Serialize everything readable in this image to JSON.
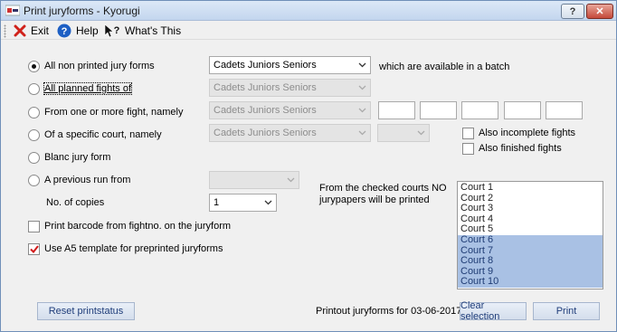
{
  "window": {
    "title": "Print juryforms - Kyorugi",
    "help_button": "?",
    "close_button": "✕"
  },
  "menu": {
    "exit": "Exit",
    "help": "Help",
    "whats_this": "What's This"
  },
  "options": {
    "all_non_printed": "All non printed jury forms",
    "all_planned": "All planned fights of",
    "from_fights": "From one or more fight, namely",
    "specific_court": "Of a specific court, namely",
    "blanc": "Blanc jury form",
    "previous_run": "A previous run from",
    "copies_label": "No. of copies"
  },
  "combos": {
    "category_1": "Cadets Juniors Seniors",
    "category_2": "Cadets Juniors Seniors",
    "category_3": "Cadets Juniors Seniors",
    "category_4": "Cadets Juniors Seniors",
    "copies": "1"
  },
  "batch_text": "which are available in a batch",
  "checks": {
    "incomplete": "Also incomplete fights",
    "finished": "Also finished fights",
    "barcode": "Print barcode from fightno. on the juryform",
    "a5": "Use A5 template for preprinted juryforms"
  },
  "courts_note": "From the checked courts NO jurypapers will be printed",
  "courts": [
    "Court 1",
    "Court 2",
    "Court 3",
    "Court 4",
    "Court 5",
    "Court 6",
    "Court 7",
    "Court 8",
    "Court 9",
    "Court 10"
  ],
  "selected_courts": [
    "Court 6",
    "Court 7",
    "Court 8",
    "Court 9",
    "Court 10"
  ],
  "footer": {
    "reset": "Reset printstatus",
    "printout": "Printout juryforms for 03-06-2017",
    "clear": "Clear selection",
    "print": "Print"
  },
  "colors": {
    "selection": "#a9c1e4",
    "button_text": "#1f3d7a",
    "check_mark": "#d11a1a"
  },
  "icons": {
    "exit": "red-x-icon",
    "help": "blue-question-icon",
    "whats_this": "cursor-question-icon"
  }
}
